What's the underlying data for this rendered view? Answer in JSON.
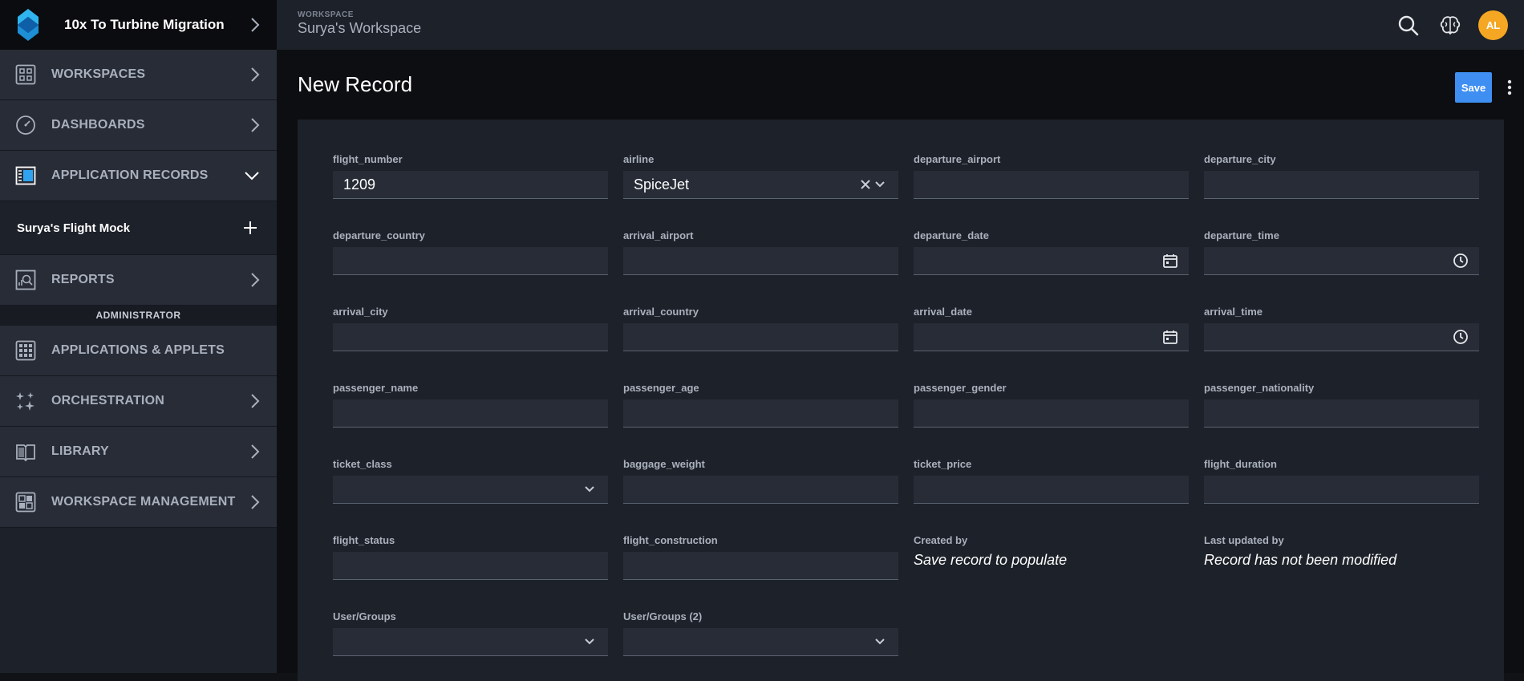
{
  "app": {
    "title": "10x To Turbine Migration"
  },
  "sidebar": {
    "items": [
      {
        "label": "WORKSPACES"
      },
      {
        "label": "DASHBOARDS"
      },
      {
        "label": "APPLICATION RECORDS"
      },
      {
        "label": "Surya's Flight Mock"
      },
      {
        "label": "REPORTS"
      },
      {
        "label": "APPLICATIONS & APPLETS"
      },
      {
        "label": "ORCHESTRATION"
      },
      {
        "label": "LIBRARY"
      },
      {
        "label": "WORKSPACE MANAGEMENT"
      }
    ],
    "section_label": "ADMINISTRATOR"
  },
  "topbar": {
    "workspace_kicker": "WORKSPACE",
    "workspace_name": "Surya's Workspace",
    "avatar_initials": "AL",
    "avatar_color": "#f5a623"
  },
  "main": {
    "title": "New Record",
    "save_label": "Save",
    "save_color": "#3f8ff2"
  },
  "form": {
    "flight_number": {
      "label": "flight_number",
      "value": "1209"
    },
    "airline": {
      "label": "airline",
      "value": "SpiceJet"
    },
    "departure_airport": {
      "label": "departure_airport",
      "value": ""
    },
    "departure_city": {
      "label": "departure_city",
      "value": ""
    },
    "departure_country": {
      "label": "departure_country",
      "value": ""
    },
    "arrival_airport": {
      "label": "arrival_airport",
      "value": ""
    },
    "departure_date": {
      "label": "departure_date",
      "value": ""
    },
    "departure_time": {
      "label": "departure_time",
      "value": ""
    },
    "arrival_city": {
      "label": "arrival_city",
      "value": ""
    },
    "arrival_country": {
      "label": "arrival_country",
      "value": ""
    },
    "arrival_date": {
      "label": "arrival_date",
      "value": ""
    },
    "arrival_time": {
      "label": "arrival_time",
      "value": ""
    },
    "passenger_name": {
      "label": "passenger_name",
      "value": ""
    },
    "passenger_age": {
      "label": "passenger_age",
      "value": ""
    },
    "passenger_gender": {
      "label": "passenger_gender",
      "value": ""
    },
    "passenger_nationality": {
      "label": "passenger_nationality",
      "value": ""
    },
    "ticket_class": {
      "label": "ticket_class",
      "value": ""
    },
    "baggage_weight": {
      "label": "baggage_weight",
      "value": ""
    },
    "ticket_price": {
      "label": "ticket_price",
      "value": ""
    },
    "flight_duration": {
      "label": "flight_duration",
      "value": ""
    },
    "flight_status": {
      "label": "flight_status",
      "value": ""
    },
    "flight_construction": {
      "label": "flight_construction",
      "value": ""
    },
    "created_by": {
      "label": "Created by",
      "value": "Save record to populate"
    },
    "last_updated_by": {
      "label": "Last updated by",
      "value": "Record has not been modified"
    },
    "user_groups": {
      "label": "User/Groups",
      "value": ""
    },
    "user_groups_2": {
      "label": "User/Groups (2)",
      "value": ""
    }
  }
}
